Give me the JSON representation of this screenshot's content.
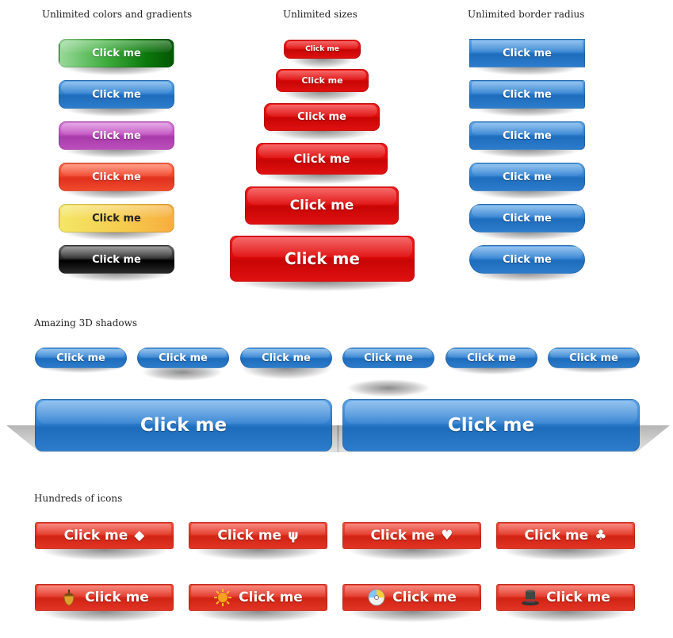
{
  "headings": {
    "colors": "Unlimited colors and gradients",
    "sizes": "Unlimited sizes",
    "radius": "Unlimited border radius",
    "shadows": "Amazing 3D shadows",
    "icons": "Hundreds of icons"
  },
  "button_label": "Click me",
  "colors_col": [
    {
      "label": "Click me",
      "style": "green"
    },
    {
      "label": "Click me",
      "style": "blue"
    },
    {
      "label": "Click me",
      "style": "purple"
    },
    {
      "label": "Click me",
      "style": "orange-red"
    },
    {
      "label": "Click me",
      "style": "yellow"
    },
    {
      "label": "Click me",
      "style": "black"
    }
  ],
  "sizes_col": [
    "Click me",
    "Click me",
    "Click me",
    "Click me",
    "Click me",
    "Click me"
  ],
  "radius_col": [
    "Click me",
    "Click me",
    "Click me",
    "Click me",
    "Click me",
    "Click me"
  ],
  "shadow_row": [
    "Click me",
    "Click me",
    "Click me",
    "Click me",
    "Click me",
    "Click me"
  ],
  "shadow_big": [
    "Click me",
    "Click me"
  ],
  "icons_row1": [
    {
      "label": "Click me",
      "glyph": "◆",
      "icon": "diamond-icon"
    },
    {
      "label": "Click me",
      "glyph": "ψ",
      "icon": "psi-icon"
    },
    {
      "label": "Click me",
      "glyph": "♥",
      "icon": "heart-icon"
    },
    {
      "label": "Click me",
      "glyph": "♣",
      "icon": "club-icon"
    }
  ],
  "icons_row2": [
    {
      "label": "Click me",
      "icon": "acorn-icon"
    },
    {
      "label": "Click me",
      "icon": "sun-icon"
    },
    {
      "label": "Click me",
      "icon": "disc-icon"
    },
    {
      "label": "Click me",
      "icon": "top-hat-icon"
    }
  ],
  "colors": {
    "blue": "#3282d2",
    "red": "#e23424",
    "text": "#222222"
  }
}
